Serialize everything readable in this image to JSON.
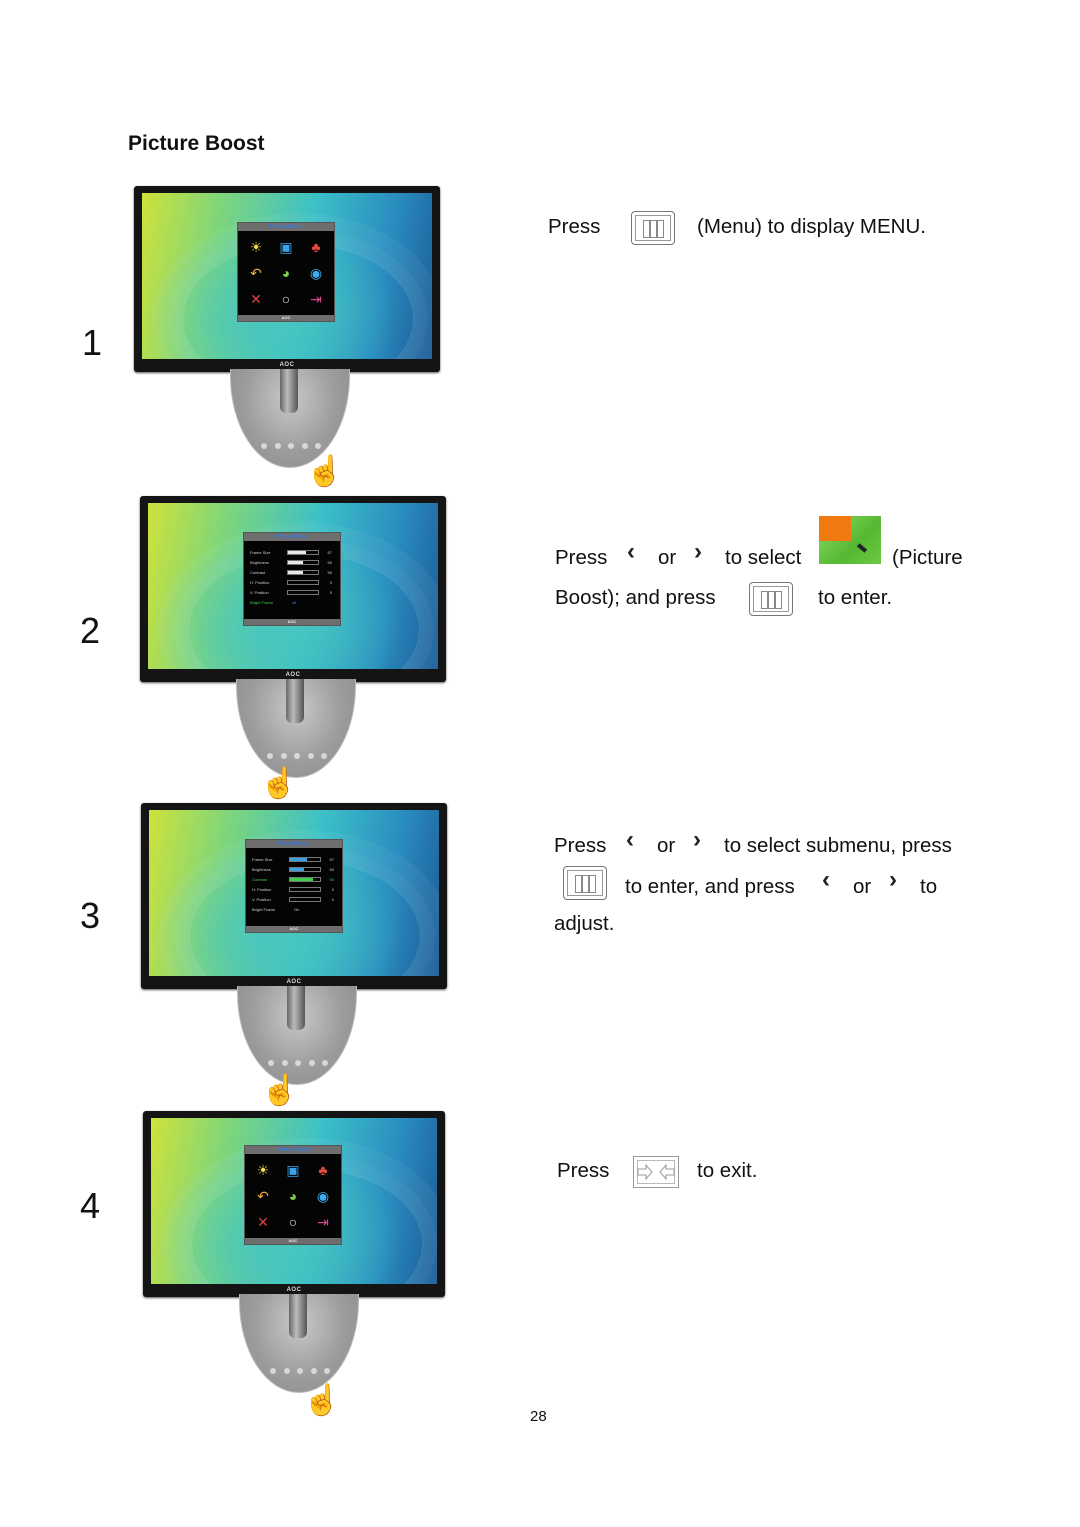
{
  "page": {
    "section_title": "Picture Boost",
    "page_number": "28"
  },
  "steps": [
    {
      "number": "1",
      "osd": {
        "type": "main-menu",
        "title": "Picture Boost",
        "brand": "AOC",
        "icons": [
          "luminance-icon",
          "image-setup-icon",
          "color-setup-icon",
          "picture-boost-icon",
          "ocd-setup-icon",
          "extra-icon",
          "factory-reset-icon",
          "osd-setup-icon",
          "exit-icon"
        ]
      },
      "text": {
        "press": "Press",
        "key": "menu-button-icon",
        "rest": "(Menu) to display MENU."
      }
    },
    {
      "number": "2",
      "osd": {
        "type": "submenu",
        "title": "Picture Boost",
        "brand": "AOC",
        "rows": [
          {
            "label": "Frame Size",
            "fill": 0.6,
            "value": "57"
          },
          {
            "label": "Brightness",
            "fill": 0.5,
            "value": "50"
          },
          {
            "label": "Contrast",
            "fill": 0.5,
            "value": "50"
          },
          {
            "label": "H. Position",
            "fill": 0,
            "value": "0"
          },
          {
            "label": "V. Position",
            "fill": 0,
            "value": "0"
          },
          {
            "label": "Bright Frame",
            "value": "off",
            "highlighted": true
          }
        ]
      },
      "text": {
        "line1_press": "Press",
        "or": "or",
        "to_select": "to select",
        "paren": "(Picture",
        "line2": "Boost); and press",
        "to_enter": "to enter."
      }
    },
    {
      "number": "3",
      "osd": {
        "type": "submenu",
        "title": "Picture Boost",
        "brand": "AOC",
        "rows": [
          {
            "label": "Frame Size",
            "fill": 0.55,
            "value": "57"
          },
          {
            "label": "Brightness",
            "fill": 0.45,
            "value": "50"
          },
          {
            "label": "Contrast",
            "fill": 0.75,
            "value": "50",
            "highlighted": true
          },
          {
            "label": "H. Position",
            "fill": 0,
            "value": "0"
          },
          {
            "label": "V. Position",
            "fill": 0,
            "value": "0"
          },
          {
            "label": "Bright Frame",
            "value": "On"
          }
        ]
      },
      "text": {
        "press": "Press",
        "or": "or",
        "to_select_submenu": "to select submenu, press",
        "to_enter_and_press": "to enter, and press",
        "or2": "or",
        "to": "to",
        "adjust": "adjust."
      }
    },
    {
      "number": "4",
      "osd": {
        "type": "main-menu",
        "title": "Picture Boost",
        "brand": "AOC"
      },
      "text": {
        "press": "Press",
        "key": "exit-button-icon",
        "rest": "to exit."
      }
    }
  ],
  "monitor": {
    "brand": "AOC"
  },
  "colors": {
    "osd_highlight": "#3fd04a",
    "osd_title": "#3a7be0",
    "picture_boost_orange": "#f07a10",
    "picture_boost_green": "#55b832"
  }
}
